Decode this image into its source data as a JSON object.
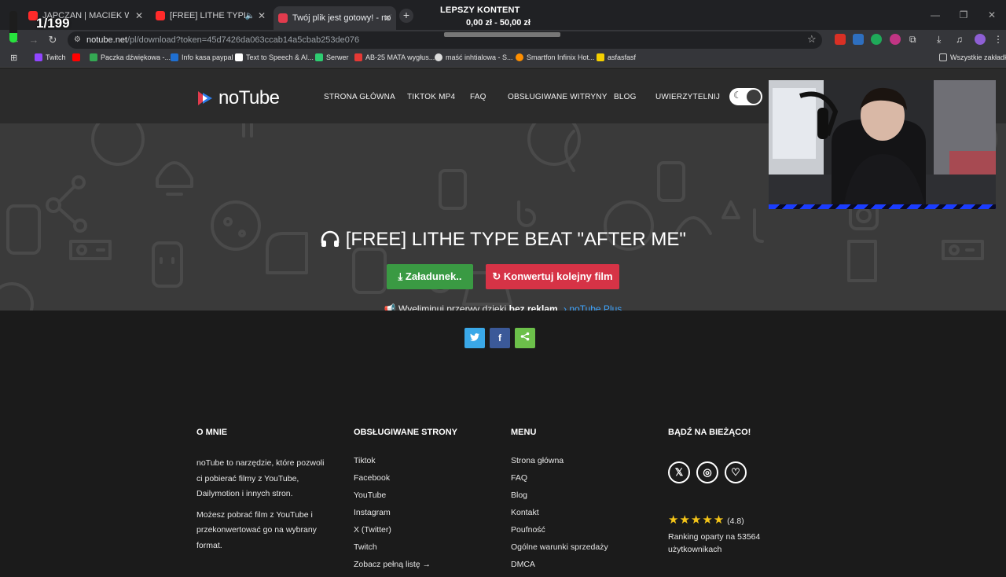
{
  "browser": {
    "tabs": [
      {
        "title": "JAPCZAN | MACIEK WPADA W...",
        "favicon_color": "#ff2a2a",
        "active": false
      },
      {
        "title": "[FREE] LITHE TYPE BEAT \"AF...",
        "favicon_color": "#ff2a2a",
        "active": false,
        "audio": true
      },
      {
        "title": "Twój plik jest gotowy! - noTube",
        "favicon_color": "#e23b4d",
        "active": true
      }
    ],
    "url_host": "notube.net",
    "url_path": "/pl/download?token=45d7426da063ccab14a5cbab253de076",
    "bookmarks": [
      {
        "label": "Twitch",
        "color": "#9146ff"
      },
      {
        "label": "",
        "color": "#ff0000"
      },
      {
        "label": "Paczka dźwiękowa -...",
        "color": "#34a853"
      },
      {
        "label": "Info kasa paypal",
        "color": "#1f6fd1"
      },
      {
        "label": "Text to Speech & AI...",
        "color": "#ffffff"
      },
      {
        "label": "Serwer",
        "color": "#2ecc71"
      },
      {
        "label": "AB-25 MATA wygłus...",
        "color": "#e53935"
      },
      {
        "label": "maść inhtialowa - S...",
        "color": "#dddddd"
      },
      {
        "label": "Smartfon Infinix Hot...",
        "color": "#ff8f00"
      },
      {
        "label": "asfasfasf",
        "color": "#f5d000"
      }
    ],
    "all_bookmarks": "Wszystkie zakładki"
  },
  "overlay": {
    "goal_label": "LEPSZY KONTENT",
    "goal_current": "0,00 zł",
    "goal_target": "50,00 zł",
    "goal_progress": 0.0,
    "counter_text": "1/199",
    "counter_progress": 0.3
  },
  "site": {
    "logo": "noTube",
    "nav": [
      "STRONA GŁÓWNA",
      "TIKTOK MP4",
      "FAQ",
      "OBSŁUGIWANE WITRYNY",
      "BLOG",
      "UWIERZYTELNIJ"
    ],
    "video_title": "[FREE] LITHE TYPE BEAT \"AFTER ME\"",
    "download_label": "Załadunek..",
    "convert_label": "Konwertuj kolejny film",
    "promo_text": "Wyeliminuj przerwy dzięki",
    "promo_bold": "bez reklam",
    "promo_link": "› noTube Plus",
    "share": [
      {
        "name": "twitter",
        "glyph": "🐦",
        "color": "#3aa8e8"
      },
      {
        "name": "facebook",
        "glyph": "f",
        "color": "#3b5998"
      },
      {
        "name": "share",
        "glyph": "⋖",
        "color": "#6cc04a"
      }
    ]
  },
  "footer": {
    "about_head": "O MNIE",
    "about_p1": "noTube to narzędzie, które pozwoli ci pobierać filmy z YouTube, Dailymotion i innych stron.",
    "about_p2": "Możesz pobrać film z YouTube i przekonwertować go na wybrany format.",
    "sites_head": "OBSŁUGIWANE STRONY",
    "sites": [
      "Tiktok",
      "Facebook",
      "YouTube",
      "Instagram",
      "X (Twitter)",
      "Twitch",
      "Zobacz pełną listę →"
    ],
    "menu_head": "MENU",
    "menu": [
      "Strona główna",
      "FAQ",
      "Blog",
      "Kontakt",
      "Poufność",
      "Ogólne warunki sprzedaży",
      "DMCA"
    ],
    "follow_head": "BĄDŹ NA BIEŻĄCO!",
    "rating_value": "(4.8)",
    "ranking_text": "Ranking oparty na 53564 użytkownikach"
  }
}
